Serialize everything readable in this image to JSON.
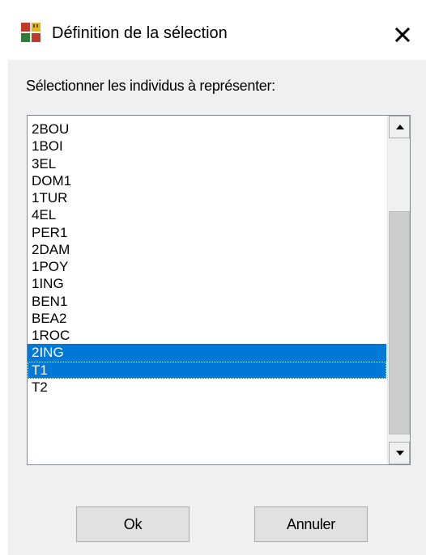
{
  "window": {
    "title": "Définition de la sélection",
    "close_label": "✕",
    "icon": "app-grid-icon"
  },
  "prompt": "Sélectionner les individus à représenter:",
  "list": {
    "items": [
      {
        "label": "2BOU",
        "selected": false
      },
      {
        "label": "1BOI",
        "selected": false
      },
      {
        "label": "3EL",
        "selected": false
      },
      {
        "label": "DOM1",
        "selected": false
      },
      {
        "label": "1TUR",
        "selected": false
      },
      {
        "label": "4EL",
        "selected": false
      },
      {
        "label": "PER1",
        "selected": false
      },
      {
        "label": "2DAM",
        "selected": false
      },
      {
        "label": "1POY",
        "selected": false
      },
      {
        "label": "1ING",
        "selected": false
      },
      {
        "label": "BEN1",
        "selected": false
      },
      {
        "label": "BEA2",
        "selected": false
      },
      {
        "label": "1ROC",
        "selected": false
      },
      {
        "label": "2ING",
        "selected": true
      },
      {
        "label": "T1",
        "selected": true,
        "focused": true
      },
      {
        "label": "T2",
        "selected": false
      }
    ],
    "selection_color": "#0078d7"
  },
  "buttons": {
    "ok_label": "Ok",
    "cancel_label": "Annuler"
  }
}
